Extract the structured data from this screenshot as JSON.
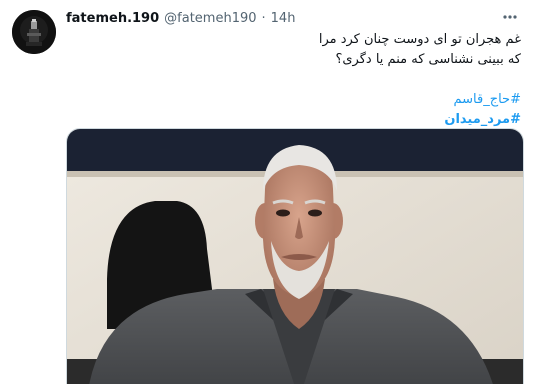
{
  "tweet": {
    "display_name": "fatemeh.190",
    "handle": "@fatemeh190",
    "separator": "·",
    "time": "14h",
    "more_icon": "more-horizontal-icon",
    "text_lines": [
      "غم هجران تو ای دوست چنان کرد مرا",
      "که ببینی نشناسی که منم یا دگری؟"
    ],
    "hashtags": [
      "#حاج_قاسم",
      "#مرد_میدان"
    ],
    "media": {
      "type": "photo",
      "description_icon": "portrait-photo"
    }
  },
  "colors": {
    "text": "#0f1419",
    "secondary": "#536471",
    "link": "#1d9bf0",
    "border": "#cfd9de"
  }
}
